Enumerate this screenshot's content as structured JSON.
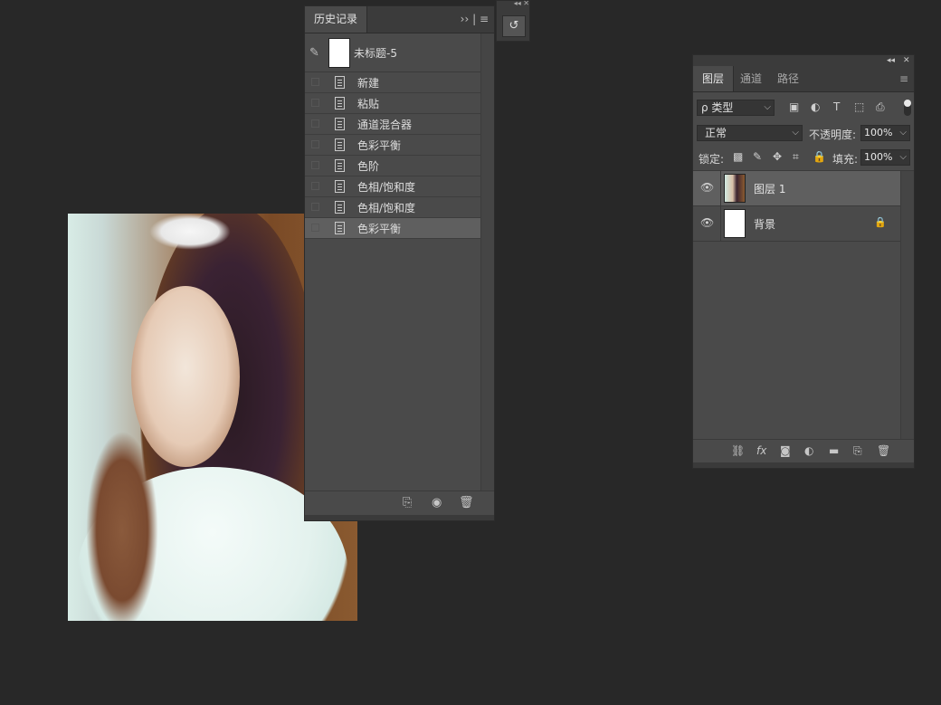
{
  "history": {
    "tab_label": "历史记录",
    "tab_icons": "›› | ≡",
    "snapshot_label": "未标题-5",
    "items": [
      {
        "label": "新建",
        "active": false
      },
      {
        "label": "粘贴",
        "active": false
      },
      {
        "label": "通道混合器",
        "active": false
      },
      {
        "label": "色彩平衡",
        "active": false
      },
      {
        "label": "色阶",
        "active": false
      },
      {
        "label": "色相/饱和度",
        "active": false
      },
      {
        "label": "色相/饱和度",
        "active": false
      },
      {
        "label": "色彩平衡",
        "active": true
      }
    ]
  },
  "layers_panel": {
    "tabs": [
      "图层",
      "通道",
      "路径"
    ],
    "active_tab": "图层",
    "filter_label": "ρ 类型",
    "blend_mode": "正常",
    "opacity_label": "不透明度:",
    "opacity_value": "100%",
    "lock_label": "锁定:",
    "fill_label": "填充:",
    "fill_value": "100%",
    "layers": [
      {
        "name": "图层 1",
        "selected": true,
        "locked": false
      },
      {
        "name": "背景",
        "selected": false,
        "locked": true
      }
    ]
  },
  "colors": {
    "app_background": "#282828",
    "panel_background": "#4a4a4a",
    "selected_row": "#5f5f5f"
  }
}
